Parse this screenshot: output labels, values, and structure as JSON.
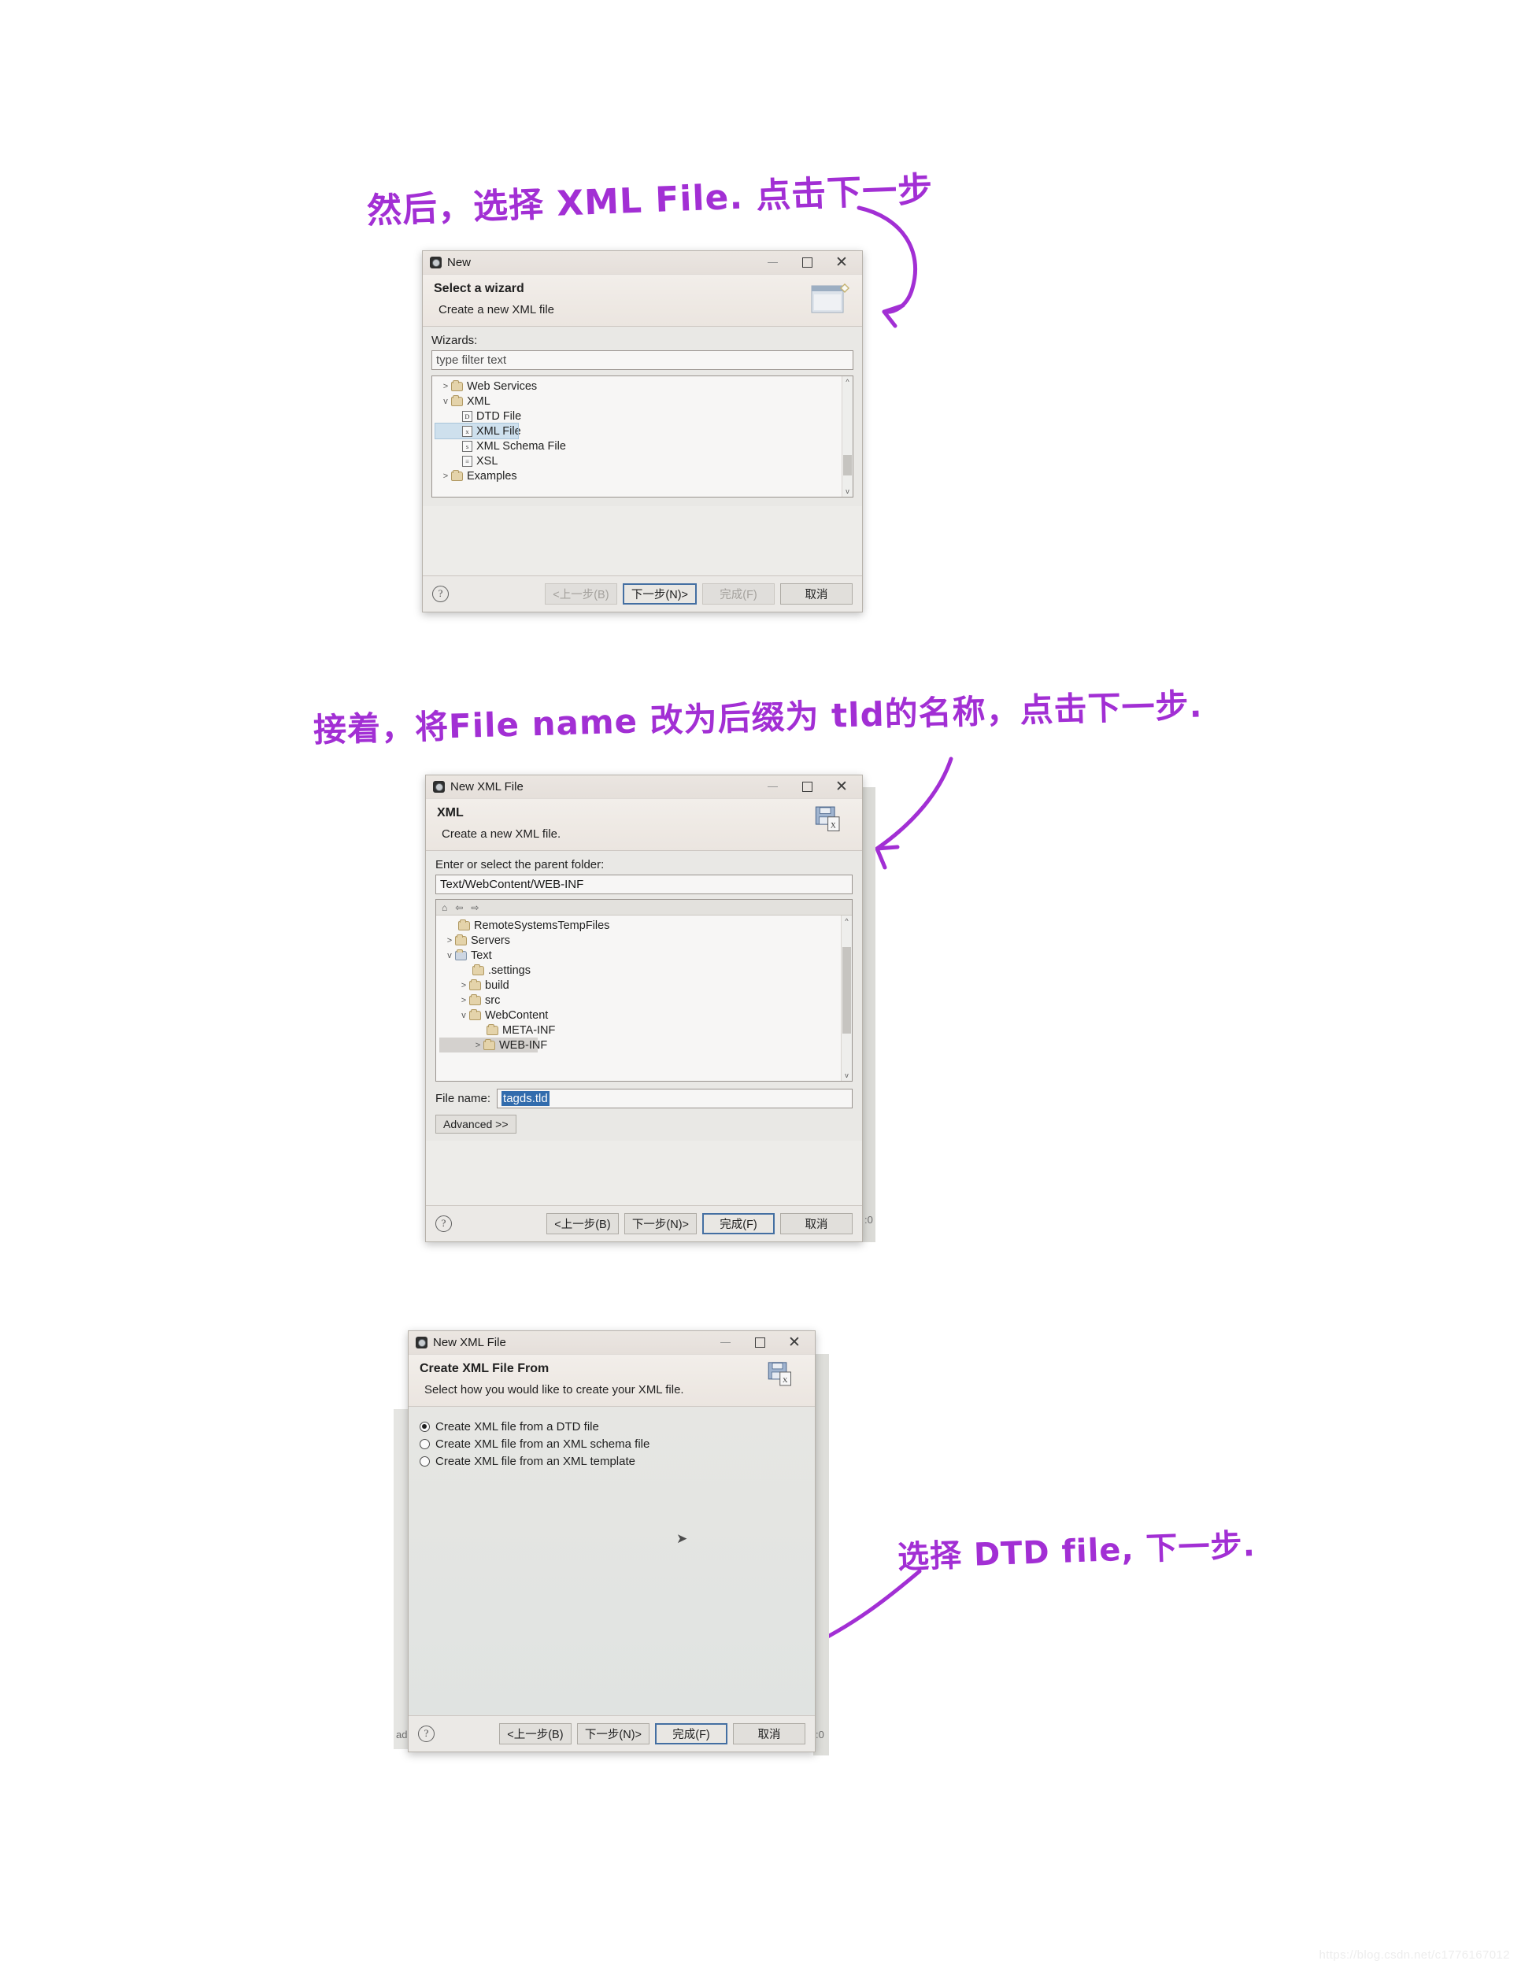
{
  "page": {
    "background": "#ffffff",
    "ink_color": "#a22fd4",
    "watermark": "https://blog.csdn.net/c1776167012"
  },
  "annotations": [
    {
      "id": "note-1",
      "text": "然后，选择 XML File. 点击下一步"
    },
    {
      "id": "note-2",
      "text": "接着，将File name 改为后缀为 tld的名称，点击下一步."
    },
    {
      "id": "note-3",
      "text": "选择 DTD file, 下一步."
    }
  ],
  "dialog1": {
    "window_title": "New",
    "window_icon": "eclipse-icon",
    "min_label": "minimize",
    "max_label": "maximize",
    "close_label": "✕",
    "head_title": "Select a wizard",
    "head_sub": "Create a new XML file",
    "head_image": "wizard-banner-icon",
    "wizards_label": "Wizards:",
    "filter_placeholder": "type filter text",
    "filter_value": "",
    "tree": [
      {
        "label": "Web Services",
        "indent": 0,
        "twisty": ">",
        "icon": "folder",
        "state": ""
      },
      {
        "label": "XML",
        "indent": 0,
        "twisty": "v",
        "icon": "folder",
        "state": ""
      },
      {
        "label": "DTD File",
        "indent": 1,
        "twisty": "",
        "icon": "file-d",
        "state": ""
      },
      {
        "label": "XML File",
        "indent": 1,
        "twisty": "",
        "icon": "file-x",
        "state": "selected"
      },
      {
        "label": "XML Schema File",
        "indent": 1,
        "twisty": "",
        "icon": "file-s",
        "state": ""
      },
      {
        "label": "XSL",
        "indent": 1,
        "twisty": "",
        "icon": "file-xsl",
        "state": ""
      },
      {
        "label": "Examples",
        "indent": 0,
        "twisty": ">",
        "icon": "folder",
        "state": ""
      }
    ],
    "scroll_up": "^",
    "scroll_down": "v",
    "help_glyph": "?",
    "buttons": [
      {
        "label": "<上一步(B)",
        "state": "disabled"
      },
      {
        "label": "下一步(N)>",
        "state": "default"
      },
      {
        "label": "完成(F)",
        "state": "disabled"
      },
      {
        "label": "取消",
        "state": "normal"
      }
    ]
  },
  "dialog2": {
    "window_title": "New XML File",
    "window_icon": "eclipse-icon",
    "close_label": "✕",
    "head_title": "XML",
    "head_sub": "Create a new XML file.",
    "head_image": "xml-file-save-icon",
    "parent_folder_label": "Enter or select the parent folder:",
    "parent_folder_value": "Text/WebContent/WEB-INF",
    "tree_toolbar_icons": [
      "home-icon",
      "back-arrow-icon",
      "forward-arrow-icon"
    ],
    "tree": [
      {
        "label": "RemoteSystemsTempFiles",
        "indent": 1,
        "twisty": "",
        "icon": "folder",
        "state": ""
      },
      {
        "label": "Servers",
        "indent": 0,
        "twisty": ">",
        "icon": "folder",
        "state": ""
      },
      {
        "label": "Text",
        "indent": 0,
        "twisty": "v",
        "icon": "project",
        "state": ""
      },
      {
        "label": ".settings",
        "indent": 2,
        "twisty": "",
        "icon": "folder",
        "state": ""
      },
      {
        "label": "build",
        "indent": 1,
        "twisty": ">",
        "icon": "folder",
        "state": ""
      },
      {
        "label": "src",
        "indent": 1,
        "twisty": ">",
        "icon": "folder",
        "state": ""
      },
      {
        "label": "WebContent",
        "indent": 1,
        "twisty": "v",
        "icon": "folder",
        "state": ""
      },
      {
        "label": "META-INF",
        "indent": 3,
        "twisty": "",
        "icon": "folder",
        "state": ""
      },
      {
        "label": "WEB-INF",
        "indent": 2,
        "twisty": ">",
        "icon": "folder",
        "state": "selected-grey"
      }
    ],
    "scroll_up": "^",
    "scroll_down": "v",
    "file_name_label": "File name:",
    "file_name_value": "tagds.tld",
    "advanced_label": "Advanced >>",
    "help_glyph": "?",
    "buttons": [
      {
        "label": "<上一步(B)",
        "state": "normal"
      },
      {
        "label": "下一步(N)>",
        "state": "normal"
      },
      {
        "label": "完成(F)",
        "state": "default"
      },
      {
        "label": "取消",
        "state": "normal"
      }
    ],
    "edge_text": ":0"
  },
  "dialog3": {
    "window_title": "New XML File",
    "window_icon": "eclipse-icon",
    "close_label": "✕",
    "head_title": "Create XML File From",
    "head_sub": "Select how you would like to create your XML file.",
    "head_image": "xml-file-save-icon",
    "options": [
      {
        "label": "Create XML file from a DTD file",
        "selected": true
      },
      {
        "label": "Create XML file from an XML schema file",
        "selected": false
      },
      {
        "label": "Create XML file from an XML template",
        "selected": false
      }
    ],
    "cursor": "pointer-arrow",
    "help_glyph": "?",
    "buttons": [
      {
        "label": "<上一步(B)",
        "state": "normal"
      },
      {
        "label": "下一步(N)>",
        "state": "normal"
      },
      {
        "label": "完成(F)",
        "state": "default"
      },
      {
        "label": "取消",
        "state": "normal"
      }
    ],
    "edge_left_text": "ad",
    "edge_right_text": ":0"
  }
}
